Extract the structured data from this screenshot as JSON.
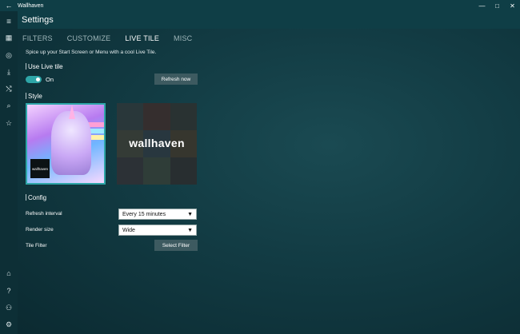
{
  "window": {
    "title": "Wallhaven",
    "back_icon": "←",
    "minimize_icon": "—",
    "maximize_icon": "□",
    "close_icon": "✕"
  },
  "header": {
    "title": "Settings",
    "menu_icon": "≡"
  },
  "rail": {
    "top": [
      {
        "name": "grid-icon",
        "glyph": "▦"
      },
      {
        "name": "globe-icon",
        "glyph": "◎"
      },
      {
        "name": "download-icon",
        "glyph": "⤓"
      },
      {
        "name": "shuffle-icon",
        "glyph": "⤭"
      },
      {
        "name": "search-icon",
        "glyph": "⌕"
      },
      {
        "name": "star-icon",
        "glyph": "☆"
      }
    ],
    "bottom": [
      {
        "name": "home-icon",
        "glyph": "⌂"
      },
      {
        "name": "help-icon",
        "glyph": "?"
      },
      {
        "name": "user-icon",
        "glyph": "⚇"
      },
      {
        "name": "settings-icon",
        "glyph": "⚙"
      }
    ]
  },
  "tabs": [
    {
      "label": "FILTERS",
      "active": false
    },
    {
      "label": "CUSTOMIZE",
      "active": false
    },
    {
      "label": "LIVE TILE",
      "active": true
    },
    {
      "label": "MISC",
      "active": false
    }
  ],
  "live_tile": {
    "description": "Spice up your Start Screen or Menu with a cool Live Tile.",
    "use_live_tile_heading": "Use Live tile",
    "toggle_state": "On",
    "refresh_now": "Refresh now",
    "style_heading": "Style",
    "tile_badge_text": "wallhaven",
    "tile_logo_text": "wallhaven"
  },
  "config": {
    "heading": "Config",
    "refresh_interval_label": "Refresh interval",
    "refresh_interval_value": "Every 15 minutes",
    "render_size_label": "Render size",
    "render_size_value": "Wide",
    "tile_filter_label": "Tile Filter",
    "select_filter": "Select Filter"
  },
  "colors": {
    "accent": "#2ea6a8",
    "chrome": "#0f3e46"
  }
}
